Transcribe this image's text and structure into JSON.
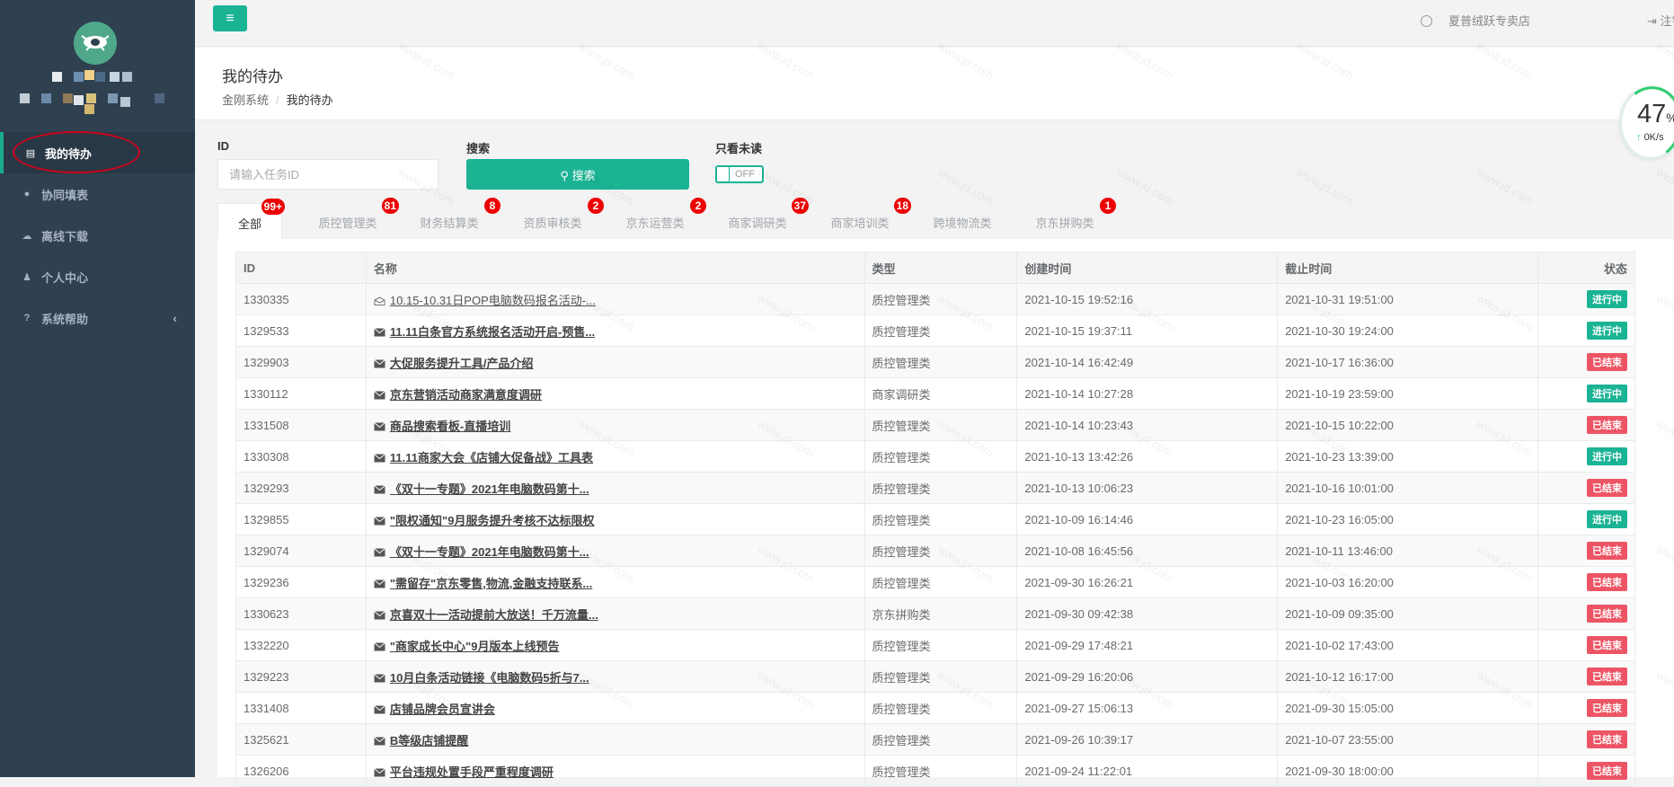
{
  "sidebar": {
    "items": [
      {
        "icon": "list-icon",
        "glyph": "▤",
        "label": "我的待办",
        "active": true
      },
      {
        "icon": "comment-icon",
        "glyph": "●",
        "label": "协同填表"
      },
      {
        "icon": "cloud-download-icon",
        "glyph": "☁",
        "label": "离线下载"
      },
      {
        "icon": "user-icon",
        "glyph": "♟",
        "label": "个人中心"
      },
      {
        "icon": "help-icon",
        "glyph": "?",
        "label": "系统帮助",
        "arrow": "‹"
      }
    ]
  },
  "topbar": {
    "menu_glyph": "≡",
    "user_name": "夏普绒跃专卖店",
    "logout_label": "⇥ 注销"
  },
  "heading": {
    "title": "我的待办",
    "breadcrumb": [
      "金刚系统",
      "我的待办"
    ]
  },
  "speed_widget": {
    "percent": "47",
    "unit": "%",
    "rate": "0K/s"
  },
  "filters": {
    "id_label": "ID",
    "id_placeholder": "请输入任务ID",
    "search_label": "搜索",
    "search_button": "搜索",
    "unread_label": "只看未读",
    "toggle_text": "OFF"
  },
  "tabs": [
    {
      "label": "全部",
      "badge": "99+",
      "active": true
    },
    {
      "label": "质控管理类",
      "badge": "81"
    },
    {
      "label": "财务结算类",
      "badge": "8"
    },
    {
      "label": "资质审核类",
      "badge": "2"
    },
    {
      "label": "京东运营类",
      "badge": "2"
    },
    {
      "label": "商家调研类",
      "badge": "37"
    },
    {
      "label": "商家培训类",
      "badge": "18"
    },
    {
      "label": "跨境物流类",
      "badge": ""
    },
    {
      "label": "京东拼购类",
      "badge": "1"
    }
  ],
  "table": {
    "columns": [
      "ID",
      "名称",
      "类型",
      "创建时间",
      "截止时间",
      "状态"
    ],
    "status_colors": {
      "进行中": "#1ab394",
      "已结束": "#ed5565"
    },
    "rows": [
      {
        "id": "1330335",
        "name": "10.15-10.31日POP电脑数码报名活动-...",
        "read": true,
        "type": "质控管理类",
        "created": "2021-10-15 19:52:16",
        "deadline": "2021-10-31 19:51:00",
        "status": "进行中"
      },
      {
        "id": "1329533",
        "name": "11.11白条官方系统报名活动开启-预售...",
        "type": "质控管理类",
        "created": "2021-10-15 19:37:11",
        "deadline": "2021-10-30 19:24:00",
        "status": "进行中"
      },
      {
        "id": "1329903",
        "name": "大促服务提升工具/产品介绍",
        "type": "质控管理类",
        "created": "2021-10-14 16:42:49",
        "deadline": "2021-10-17 16:36:00",
        "status": "已结束"
      },
      {
        "id": "1330112",
        "name": "京东营销活动商家满意度调研",
        "type": "商家调研类",
        "created": "2021-10-14 10:27:28",
        "deadline": "2021-10-19 23:59:00",
        "status": "进行中"
      },
      {
        "id": "1331508",
        "name": "商品搜索看板-直播培训",
        "type": "质控管理类",
        "created": "2021-10-14 10:23:43",
        "deadline": "2021-10-15 10:22:00",
        "status": "已结束"
      },
      {
        "id": "1330308",
        "name": "11.11商家大会《店铺大促备战》工具表",
        "type": "质控管理类",
        "created": "2021-10-13 13:42:26",
        "deadline": "2021-10-23 13:39:00",
        "status": "进行中"
      },
      {
        "id": "1329293",
        "name": "《双十一专题》2021年电脑数码第十...",
        "type": "质控管理类",
        "created": "2021-10-13 10:06:23",
        "deadline": "2021-10-16 10:01:00",
        "status": "已结束"
      },
      {
        "id": "1329855",
        "name": "\"限权通知\"9月服务提升考核不达标限权",
        "type": "质控管理类",
        "created": "2021-10-09 16:14:46",
        "deadline": "2021-10-23 16:05:00",
        "status": "进行中"
      },
      {
        "id": "1329074",
        "name": "《双十一专题》2021年电脑数码第十...",
        "type": "质控管理类",
        "created": "2021-10-08 16:45:56",
        "deadline": "2021-10-11 13:46:00",
        "status": "已结束"
      },
      {
        "id": "1329236",
        "name": "\"需留存\"京东零售,物流,金融支持联系...",
        "type": "质控管理类",
        "created": "2021-09-30 16:26:21",
        "deadline": "2021-10-03 16:20:00",
        "status": "已结束"
      },
      {
        "id": "1330623",
        "name": "京喜双十一活动提前大放送！千万流量...",
        "type": "京东拼购类",
        "created": "2021-09-30 09:42:38",
        "deadline": "2021-10-09 09:35:00",
        "status": "已结束"
      },
      {
        "id": "1332220",
        "name": "\"商家成长中心\"9月版本上线预告",
        "type": "质控管理类",
        "created": "2021-09-29 17:48:21",
        "deadline": "2021-10-02 17:43:00",
        "status": "已结束"
      },
      {
        "id": "1329223",
        "name": "10月白条活动链接《电脑数码5折与7...",
        "type": "质控管理类",
        "created": "2021-09-29 16:20:06",
        "deadline": "2021-10-12 16:17:00",
        "status": "已结束"
      },
      {
        "id": "1331408",
        "name": "店铺品牌会员宣讲会",
        "type": "质控管理类",
        "created": "2021-09-27 15:06:13",
        "deadline": "2021-09-30 15:05:00",
        "status": "已结束"
      },
      {
        "id": "1325621",
        "name": "B等级店铺提醒",
        "type": "质控管理类",
        "created": "2021-09-26 10:39:17",
        "deadline": "2021-10-07 23:55:00",
        "status": "已结束"
      },
      {
        "id": "1326206",
        "name": "平台违规处置手段严重程度调研",
        "type": "质控管理类",
        "created": "2021-09-24 11:22:01",
        "deadline": "2021-09-30 18:00:00",
        "status": "已结束"
      }
    ]
  },
  "watermark": "www.jd.com"
}
